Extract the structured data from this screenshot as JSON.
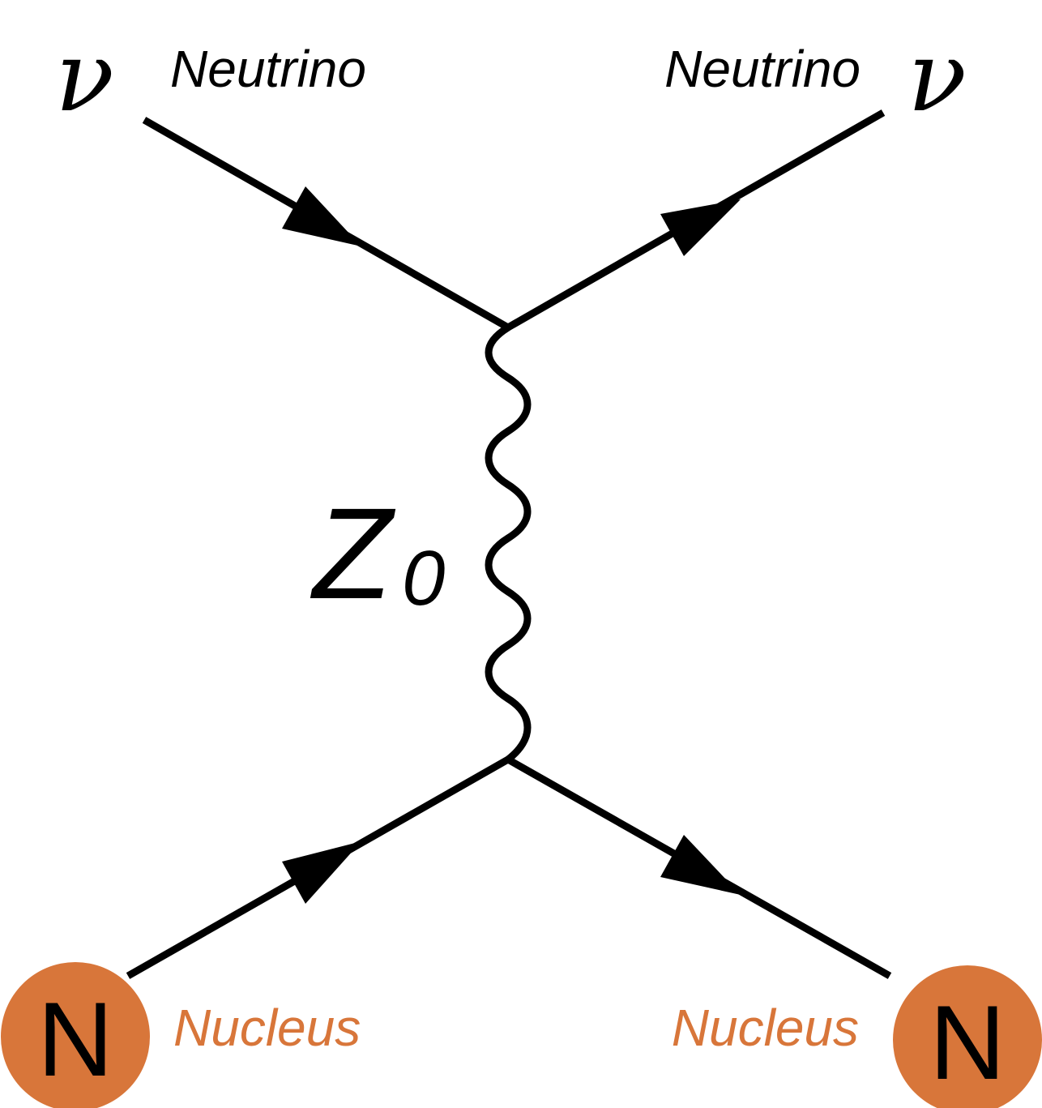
{
  "top": {
    "left_symbol": "ν",
    "left_label": "Neutrino",
    "right_label": "Neutrino",
    "right_symbol": "ν"
  },
  "boson": {
    "label_main": "Z",
    "label_sub": "0"
  },
  "bottom": {
    "left_symbol": "N",
    "left_label": "Nucleus",
    "right_label": "Nucleus",
    "right_symbol": "N"
  },
  "colors": {
    "line": "#000000",
    "nucleus_fill": "#d8763a",
    "nucleus_label": "#d8763a"
  }
}
